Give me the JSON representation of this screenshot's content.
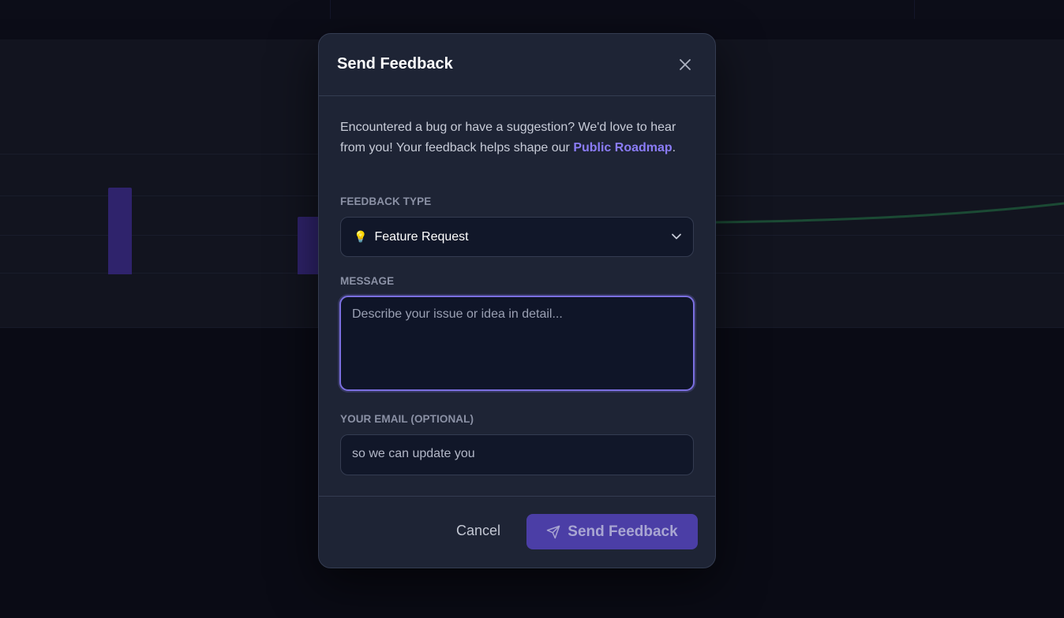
{
  "modal": {
    "title": "Send Feedback",
    "intro_text": "Encountered a bug or have a suggestion? We'd love to hear from you! Your feedback helps shape our ",
    "intro_link": "Public Roadmap",
    "intro_suffix": "."
  },
  "feedback_type": {
    "label": "FEEDBACK TYPE",
    "selected_icon": "lightbulb-icon",
    "selected_value": "Feature Request"
  },
  "message": {
    "label": "MESSAGE",
    "placeholder": "Describe your issue or idea in detail..."
  },
  "email": {
    "label": "YOUR EMAIL (OPTIONAL)",
    "placeholder": "so we can update you"
  },
  "footer": {
    "cancel_label": "Cancel",
    "send_label": "Send Feedback"
  },
  "colors": {
    "accent": "#7b6fe0",
    "link": "#8b7cf6",
    "send_button": "#4b3ea6",
    "modal_bg": "#1e2435"
  }
}
